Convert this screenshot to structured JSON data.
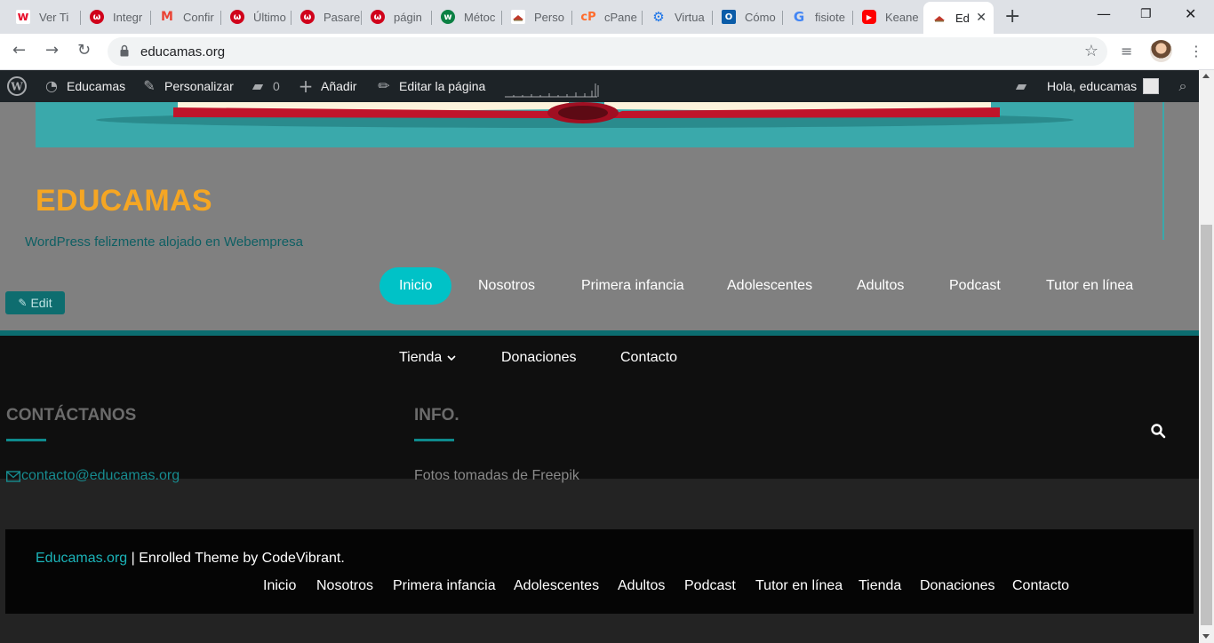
{
  "browser": {
    "tabs": [
      {
        "title": "Ver Ti",
        "icon": "w-logo-icon",
        "color": "#e8112d"
      },
      {
        "title": "Integr",
        "icon": "webempresa-icon",
        "color": "#d0021b"
      },
      {
        "title": "Confir",
        "icon": "gmail-icon",
        "color": "#ea4335"
      },
      {
        "title": "Último",
        "icon": "webempresa-icon",
        "color": "#d0021b"
      },
      {
        "title": "Pasare",
        "icon": "webempresa-icon",
        "color": "#d0021b"
      },
      {
        "title": "págin",
        "icon": "webempresa-icon",
        "color": "#d0021b"
      },
      {
        "title": "Métoc",
        "icon": "green-w-icon",
        "color": "#0b8043"
      },
      {
        "title": "Perso",
        "icon": "educamas-icon",
        "color": "#c0392b"
      },
      {
        "title": "cPane",
        "icon": "cpanel-icon",
        "color": "#ff6c2c"
      },
      {
        "title": "Virtua",
        "icon": "gear-icon",
        "color": "#1a73e8"
      },
      {
        "title": "Cómo",
        "icon": "outlook-icon",
        "color": "#0b5ca8"
      },
      {
        "title": "fisiote",
        "icon": "google-icon",
        "color": "#4285f4"
      },
      {
        "title": "Keane",
        "icon": "youtube-icon",
        "color": "#ff0000"
      },
      {
        "title": "Ed",
        "icon": "educamas-icon",
        "color": "#c0392b",
        "active": true
      }
    ],
    "new_tab": "+",
    "url": "educamas.org"
  },
  "adminbar": {
    "site_name": "Educamas",
    "customize": "Personalizar",
    "comments": "0",
    "add_new": "Añadir",
    "edit_page": "Editar la página",
    "greeting": "Hola, educamas"
  },
  "site": {
    "title": "EDUCAMAS",
    "tagline": "WordPress felizmente alojado en Webempresa",
    "edit_label": "Edit",
    "primary_menu": [
      "Inicio",
      "Nosotros",
      "Primera infancia",
      "Adolescentes",
      "Adultos",
      "Podcast",
      "Tutor en línea"
    ],
    "secondary_menu": {
      "tienda": "Tienda",
      "donaciones": "Donaciones",
      "contacto": "Contacto"
    },
    "accent_color": "#00c2c7",
    "title_color": "#f5a623"
  },
  "widgets": {
    "contact_title": "CONTÁCTANOS",
    "contact_email": "contacto@educamas.org",
    "info_title": "INFO.",
    "info_text": "Fotos tomadas de Freepik"
  },
  "footer": {
    "site_link": "Educamas.org",
    "credit": " | Enrolled Theme by CodeVibrant.",
    "menu": [
      "Inicio",
      "Nosotros",
      "Primera infancia",
      "Adolescentes",
      "Adultos",
      "Podcast",
      "Tutor en línea",
      "Tienda",
      "Donaciones",
      "Contacto"
    ]
  }
}
